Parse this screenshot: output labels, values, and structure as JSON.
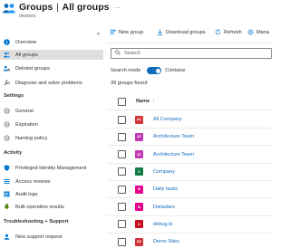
{
  "header": {
    "title": "Groups",
    "separator": "|",
    "subtitle_title": "All groups",
    "org": "devworx",
    "more": "..."
  },
  "sidebar": {
    "collapse_glyph": "«",
    "items": [
      {
        "label": "Overview",
        "icon": "info-icon",
        "color": "#0078d4"
      },
      {
        "label": "All groups",
        "icon": "groups-icon",
        "color": "#0078d4",
        "selected": true
      },
      {
        "label": "Deleted groups",
        "icon": "deleted-groups-icon",
        "color": "#0078d4"
      },
      {
        "label": "Diagnose and solve problems",
        "icon": "wrench-icon",
        "color": "#605e5c"
      }
    ],
    "sections": [
      {
        "title": "Settings",
        "items": [
          {
            "label": "General",
            "icon": "gear-icon",
            "color": "#605e5c"
          },
          {
            "label": "Expiration",
            "icon": "gear-icon",
            "color": "#605e5c"
          },
          {
            "label": "Naming policy",
            "icon": "gear-icon",
            "color": "#605e5c"
          }
        ]
      },
      {
        "title": "Activity",
        "items": [
          {
            "label": "Privileged Identity Management",
            "icon": "pim-icon",
            "color": "#0078d4"
          },
          {
            "label": "Access reviews",
            "icon": "access-reviews-icon",
            "color": "#0078d4"
          },
          {
            "label": "Audit logs",
            "icon": "audit-log-icon",
            "color": "#0078d4"
          },
          {
            "label": "Bulk operation results",
            "icon": "bulk-icon",
            "color": "#498205"
          }
        ]
      },
      {
        "title": "Troubleshooting + Support",
        "items": [
          {
            "label": "New support request",
            "icon": "support-icon",
            "color": "#0078d4"
          }
        ]
      }
    ]
  },
  "toolbar": {
    "new_group": "New group",
    "download_groups": "Download groups",
    "refresh": "Refresh",
    "manage": "Mana"
  },
  "search": {
    "placeholder": "Search"
  },
  "search_mode": {
    "label": "Search mode",
    "value": "Contains",
    "enabled": true
  },
  "results": {
    "count_text": "39 groups found"
  },
  "table": {
    "header": {
      "name": "Name",
      "sort": "↑"
    },
    "rows": [
      {
        "initials": "AC",
        "name": "All Company",
        "color": "#d13438"
      },
      {
        "initials": "AT",
        "name": "Architecture Team",
        "color": "#c239b3"
      },
      {
        "initials": "AT",
        "name": "Architecture Team",
        "color": "#c239b3"
      },
      {
        "initials": "C",
        "name": "Company",
        "color": "#107c41"
      },
      {
        "initials": "DI",
        "name": "Daily tasks",
        "color": "#e3008c"
      },
      {
        "initials": "DI",
        "name": "Datastars",
        "color": "#e3008c"
      },
      {
        "initials": "D",
        "name": "debug.ts",
        "color": "#c50f1f"
      },
      {
        "initials": "DS",
        "name": "Demo Sites",
        "color": "#d13438"
      }
    ]
  }
}
